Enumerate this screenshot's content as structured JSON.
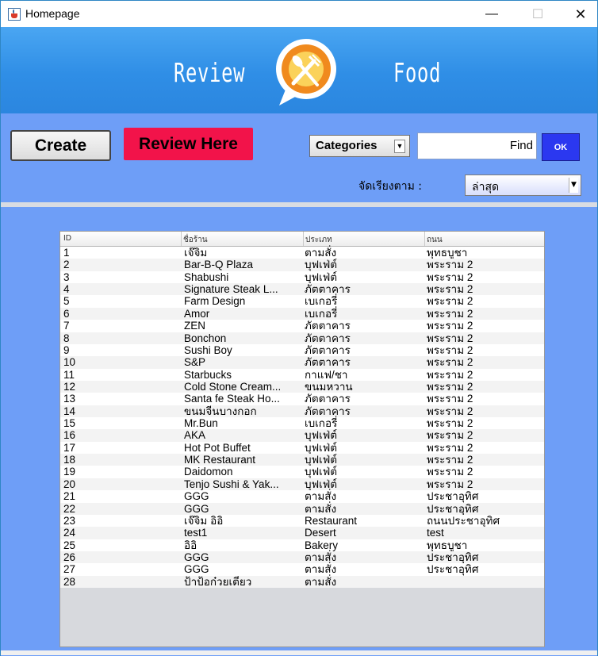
{
  "window": {
    "title": "Homepage",
    "min": "—",
    "max": "☐",
    "close": "✕"
  },
  "banner": {
    "left_text": "Review",
    "right_text": "Food",
    "logo_icon": "fork-knife-chat-icon"
  },
  "toolbar": {
    "create_label": "Create",
    "review_label": "Review Here",
    "categories_label": "Categories",
    "search_value": "Find",
    "ok_label": "OK",
    "sort_label": "จัดเรียงตาม :",
    "sort_value": "ล่าสุด"
  },
  "table": {
    "columns": [
      "ID",
      "ชื่อร้าน",
      "ประเภท",
      "ถนน"
    ],
    "rows": [
      [
        "1",
        "เจ๊จิม",
        "ตามสั่ง",
        "พุทธบูชา"
      ],
      [
        "2",
        "Bar-B-Q Plaza",
        "บุฟเฟ่ต์",
        "พระราม 2"
      ],
      [
        "3",
        "Shabushi",
        "บุฟเฟ่ต์",
        "พระราม 2"
      ],
      [
        "4",
        "Signature Steak L...",
        "ภัตตาคาร",
        "พระราม 2"
      ],
      [
        "5",
        "Farm Design",
        "เบเกอรี่",
        "พระราม 2"
      ],
      [
        "6",
        "Amor",
        "เบเกอรี่",
        "พระราม 2"
      ],
      [
        "7",
        "ZEN",
        "ภัตตาคาร",
        "พระราม 2"
      ],
      [
        "8",
        "Bonchon",
        "ภัตตาคาร",
        "พระราม 2"
      ],
      [
        "9",
        "Sushi Boy",
        "ภัตตาคาร",
        "พระราม 2"
      ],
      [
        "10",
        "S&P",
        "ภัตตาคาร",
        "พระราม 2"
      ],
      [
        "11",
        "Starbucks",
        "กาแฟ/ชา",
        "พระราม 2"
      ],
      [
        "12",
        "Cold Stone Cream...",
        "ขนมหวาน",
        "พระราม 2"
      ],
      [
        "13",
        "Santa fe Steak Ho...",
        "ภัตตาคาร",
        "พระราม 2"
      ],
      [
        "14",
        "ขนมจีนบางกอก",
        "ภัตตาคาร",
        "พระราม 2"
      ],
      [
        "15",
        "Mr.Bun",
        "เบเกอรี่",
        "พระราม 2"
      ],
      [
        "16",
        "AKA",
        "บุฟเฟ่ต์",
        "พระราม 2"
      ],
      [
        "17",
        "Hot Pot Buffet",
        "บุฟเฟ่ต์",
        "พระราม 2"
      ],
      [
        "18",
        "MK Restaurant",
        "บุฟเฟ่ต์",
        "พระราม 2"
      ],
      [
        "19",
        "Daidomon",
        "บุฟเฟ่ต์",
        "พระราม 2"
      ],
      [
        "20",
        "Tenjo Sushi & Yak...",
        "บุฟเฟ่ต์",
        "พระราม 2"
      ],
      [
        "21",
        "GGG",
        "ตามสั่ง",
        "ประชาอุทิศ"
      ],
      [
        "22",
        "GGG",
        "ตามสั่ง",
        "ประชาอุทิศ"
      ],
      [
        "23",
        "เจ๊จิม อิอิ",
        "Restaurant",
        "ถนนประชาอุทิศ"
      ],
      [
        "24",
        "test1",
        "Desert",
        "test"
      ],
      [
        "25",
        "อิอิ",
        "Bakery",
        "พุทธบูชา"
      ],
      [
        "26",
        "GGG",
        "ตามสั่ง",
        "ประชาอุทิศ"
      ],
      [
        "27",
        "GGG",
        "ตามสั่ง",
        "ประชาอุทิศ"
      ],
      [
        "28",
        "ป้าป้อก๋วยเตี๋ยว",
        "ตามสั่ง",
        ""
      ]
    ]
  },
  "colors": {
    "banner": "#2f8ee6",
    "panel": "#6e9ef7",
    "review_button": "#f2134a",
    "ok_button": "#2b38f0"
  }
}
